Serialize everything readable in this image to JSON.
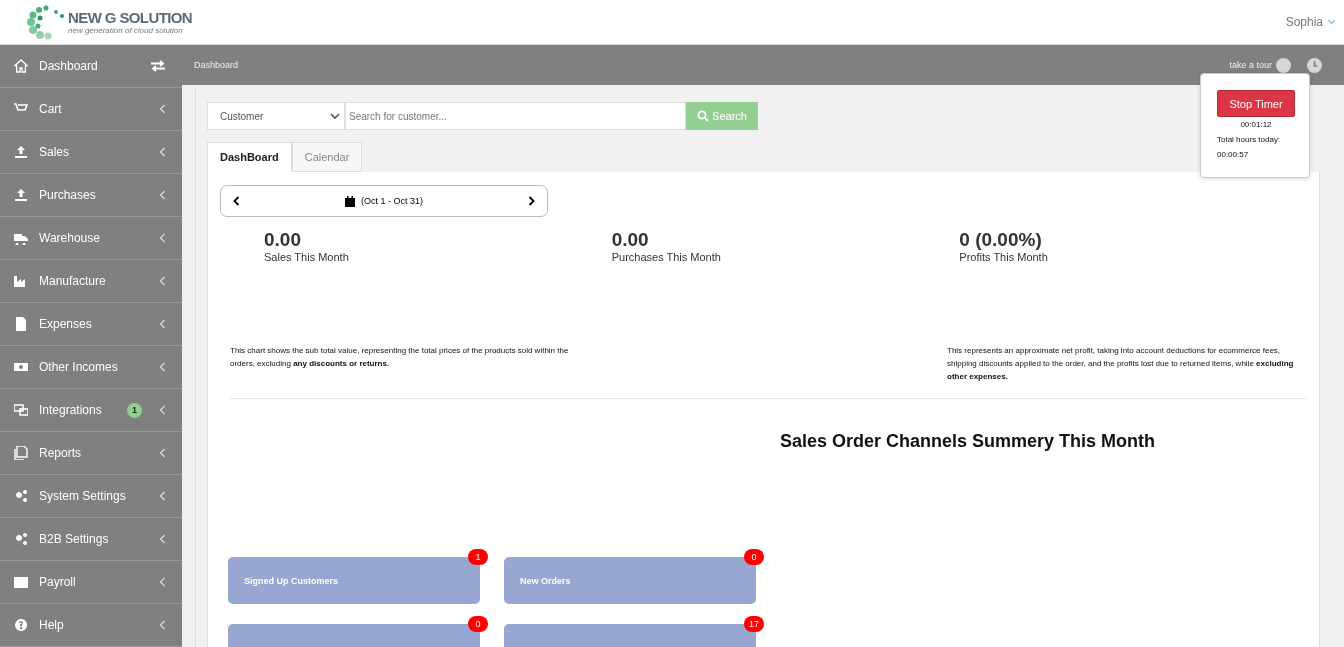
{
  "logo": {
    "title": "NEW G SOLUTION",
    "tagline": "new generation of cloud solution"
  },
  "user": {
    "name": "Sophia"
  },
  "sidebar": {
    "items": [
      {
        "label": "Dashboard"
      },
      {
        "label": "Cart"
      },
      {
        "label": "Sales"
      },
      {
        "label": "Purchases"
      },
      {
        "label": "Warehouse"
      },
      {
        "label": "Manufacture"
      },
      {
        "label": "Expenses"
      },
      {
        "label": "Other Incomes"
      },
      {
        "label": "Integrations",
        "badge": "1"
      },
      {
        "label": "Reports"
      },
      {
        "label": "System Settings"
      },
      {
        "label": "B2B Settings"
      },
      {
        "label": "Payroll"
      },
      {
        "label": "Help"
      }
    ]
  },
  "breadcrumb": "Dashboard",
  "tour": "take a tour",
  "timer": {
    "button": "Stop Timer",
    "elapsed": "00:01:12",
    "total_label": "Total hours today:",
    "total": "00:00:57"
  },
  "search": {
    "type": "Customer",
    "placeholder": "Search for customer...",
    "button": "Search"
  },
  "tabs": [
    {
      "label": "DashBoard",
      "selected": true
    },
    {
      "label": "Calendar",
      "selected": false
    }
  ],
  "period": "(Oct 1 - Oct 31)",
  "stats": [
    {
      "value": "0.00",
      "label": "Sales This Month"
    },
    {
      "value": "0.00",
      "label": "Purchases This Month"
    },
    {
      "value": "0 (0.00%)",
      "label": "Profits This Month"
    }
  ],
  "notes": [
    "This chart shows the sub total value, representing the total prices of the products sold within the orders, excluding **any discounts or returns.**",
    "This represents an approximate net profit, taking into account deductions for ecommerce fees, shipping discounts applied to the order, and the profits lost due to returned items, while **excluding other expenses.**"
  ],
  "channels_title": "Sales Order Channels Summery This Month",
  "tiles": [
    {
      "label": "Signed Up Customers",
      "count": "1"
    },
    {
      "label": "New Orders",
      "count": "0"
    },
    {
      "count": "0"
    },
    {
      "count": "17"
    }
  ]
}
